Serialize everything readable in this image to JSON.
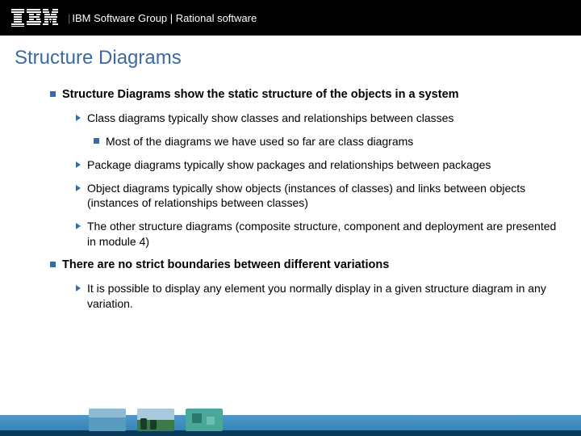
{
  "header": {
    "brand": "IBM",
    "text": "IBM Software Group | Rational software"
  },
  "slide": {
    "title": "Structure Diagrams",
    "bullets": [
      {
        "text": "Structure Diagrams show the static structure of the objects in a system",
        "subs": [
          {
            "text": "Class diagrams typically show classes and relationships between classes",
            "subs": [
              {
                "text": "Most of the diagrams we have used so far are class diagrams"
              }
            ]
          },
          {
            "text": "Package diagrams typically show packages and relationships between packages"
          },
          {
            "text": "Object diagrams typically show objects (instances of classes) and links between objects (instances of relationships between classes)"
          },
          {
            "text": "The other structure diagrams (composite structure, component and deployment are presented in module 4)"
          }
        ]
      },
      {
        "text": "There are no strict boundaries between different variations",
        "subs": [
          {
            "text": "It is possible to display any element you normally display in a given structure diagram in any variation."
          }
        ]
      }
    ]
  }
}
